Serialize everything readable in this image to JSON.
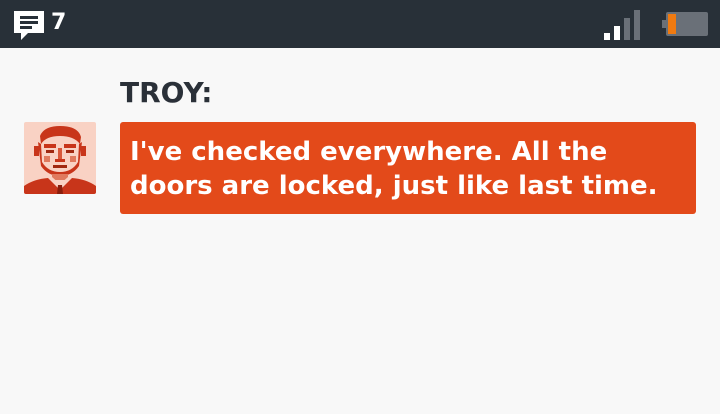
{
  "status_bar": {
    "message_count": "7",
    "signal_level": 0.5,
    "battery_level": 0.2,
    "colors": {
      "background": "#283038",
      "battery_fill": "#f07a10"
    }
  },
  "dialogue": {
    "speaker": "TROY:",
    "message": "I've checked everywhere. All the doors are locked, just like last time.",
    "colors": {
      "bubble": "#e34a1a",
      "speaker": "#2a3038"
    }
  }
}
